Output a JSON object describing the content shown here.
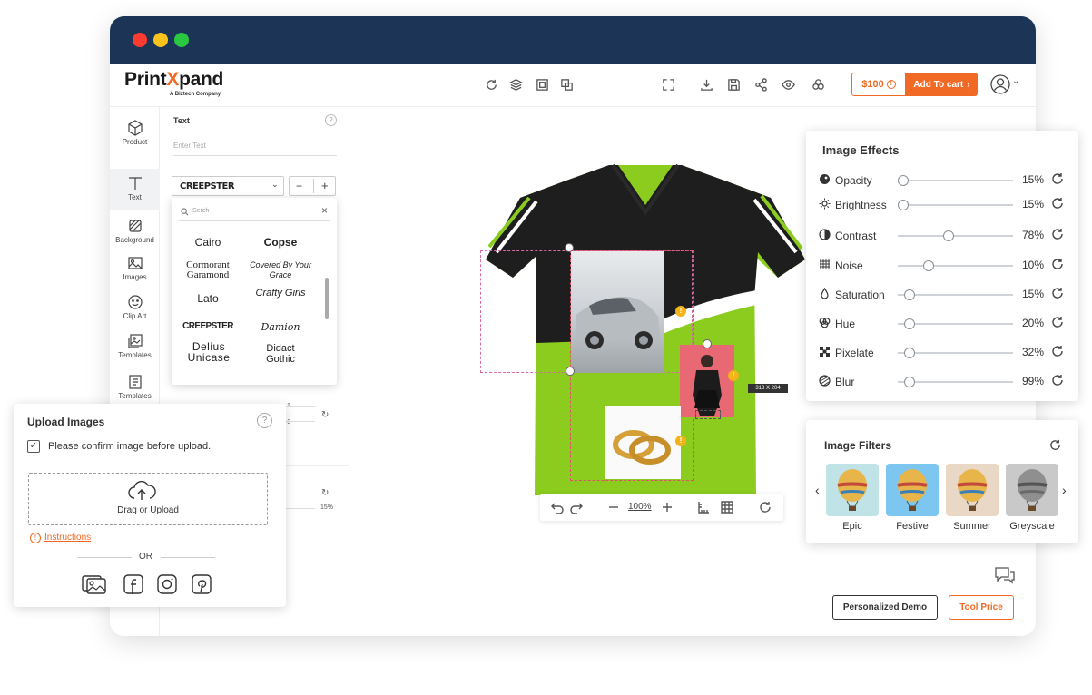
{
  "window": {
    "traffic_lights": [
      "#ff3b30",
      "#ffc41c",
      "#2ac840"
    ]
  },
  "brand": {
    "logo_part1": "Print",
    "logo_x": "X",
    "logo_part2": "pand",
    "tagline": "A Biztech Company",
    "accent": "#f06a25"
  },
  "toolbar": {
    "left_icons": [
      "refresh-icon",
      "layers-icon",
      "group-icon",
      "duplicate-icon"
    ],
    "right_icons": [
      "fullscreen-icon",
      "download-icon",
      "save-icon",
      "share-icon",
      "preview-icon",
      "3d-icon"
    ],
    "price": "$100",
    "add_to_cart": "Add To cart"
  },
  "sidebar": {
    "items": [
      {
        "label": "Product",
        "icon": "cube-icon"
      },
      {
        "label": "Text",
        "icon": "text-icon",
        "active": true
      },
      {
        "label": "Background",
        "icon": "background-icon"
      },
      {
        "label": "Images",
        "icon": "image-icon"
      },
      {
        "label": "Clip Art",
        "icon": "clipart-icon"
      },
      {
        "label": "Templates",
        "icon": "templates-icon"
      },
      {
        "label": "Templates",
        "icon": "templates-list-icon"
      }
    ]
  },
  "text_panel": {
    "title": "Text",
    "placeholder": "Enter Text",
    "font_selected": "CREEPSTER",
    "stepper_minus": "−",
    "stepper_plus": "+",
    "values": {
      "row1": "1",
      "row2": "-3",
      "row3": "15%"
    }
  },
  "font_dropdown": {
    "search_placeholder": "Serch",
    "fonts": [
      [
        "Cairo",
        "Copse"
      ],
      [
        "Cormorant Garamond",
        "Covered By Your Grace"
      ],
      [
        "Lato",
        "Crafty Girls"
      ],
      [
        "CREEPSTER",
        "Damion"
      ],
      [
        "Delius Unicase",
        "Didact Gothic"
      ]
    ]
  },
  "canvas": {
    "selection_size": "313 X 204",
    "warning_glyph": "!"
  },
  "image_effects": {
    "title": "Image Effects",
    "items": [
      {
        "label": "Opacity",
        "value": "15%",
        "level": 0.05,
        "icon": "opacity-icon"
      },
      {
        "label": "Brightness",
        "value": "15%",
        "level": 0.05,
        "icon": "brightness-icon"
      },
      {
        "label": "Contrast",
        "value": "78%",
        "level": 0.44,
        "icon": "contrast-icon"
      },
      {
        "label": "Noise",
        "value": "10%",
        "level": 0.27,
        "icon": "noise-icon"
      },
      {
        "label": "Saturation",
        "value": "15%",
        "level": 0.1,
        "icon": "saturation-icon"
      },
      {
        "label": "Hue",
        "value": "20%",
        "level": 0.1,
        "icon": "hue-icon"
      },
      {
        "label": "Pixelate",
        "value": "32%",
        "level": 0.1,
        "icon": "pixelate-icon"
      },
      {
        "label": "Blur",
        "value": "99%",
        "level": 0.1,
        "icon": "blur-icon"
      }
    ]
  },
  "image_filters": {
    "title": "Image Filters",
    "filters": [
      {
        "label": "Epic",
        "tint": "#bfe3e6"
      },
      {
        "label": "Festive",
        "tint": "#7cc6ef"
      },
      {
        "label": "Summer",
        "tint": "#ead8c6"
      },
      {
        "label": "Greyscale",
        "tint": "#c9c9c9"
      }
    ]
  },
  "upload": {
    "title": "Upload Images",
    "confirm": "Please confirm image before upload.",
    "drop_label": "Drag or Upload",
    "instructions": "Instructions",
    "or": "OR",
    "sources": [
      "gallery-icon",
      "facebook-icon",
      "instagram-icon",
      "pinterest-icon"
    ]
  },
  "bottom_toolbar": {
    "zoom": "100%"
  },
  "buttons": {
    "personalized_demo": "Personalized Demo",
    "tool_price": "Tool Price"
  }
}
